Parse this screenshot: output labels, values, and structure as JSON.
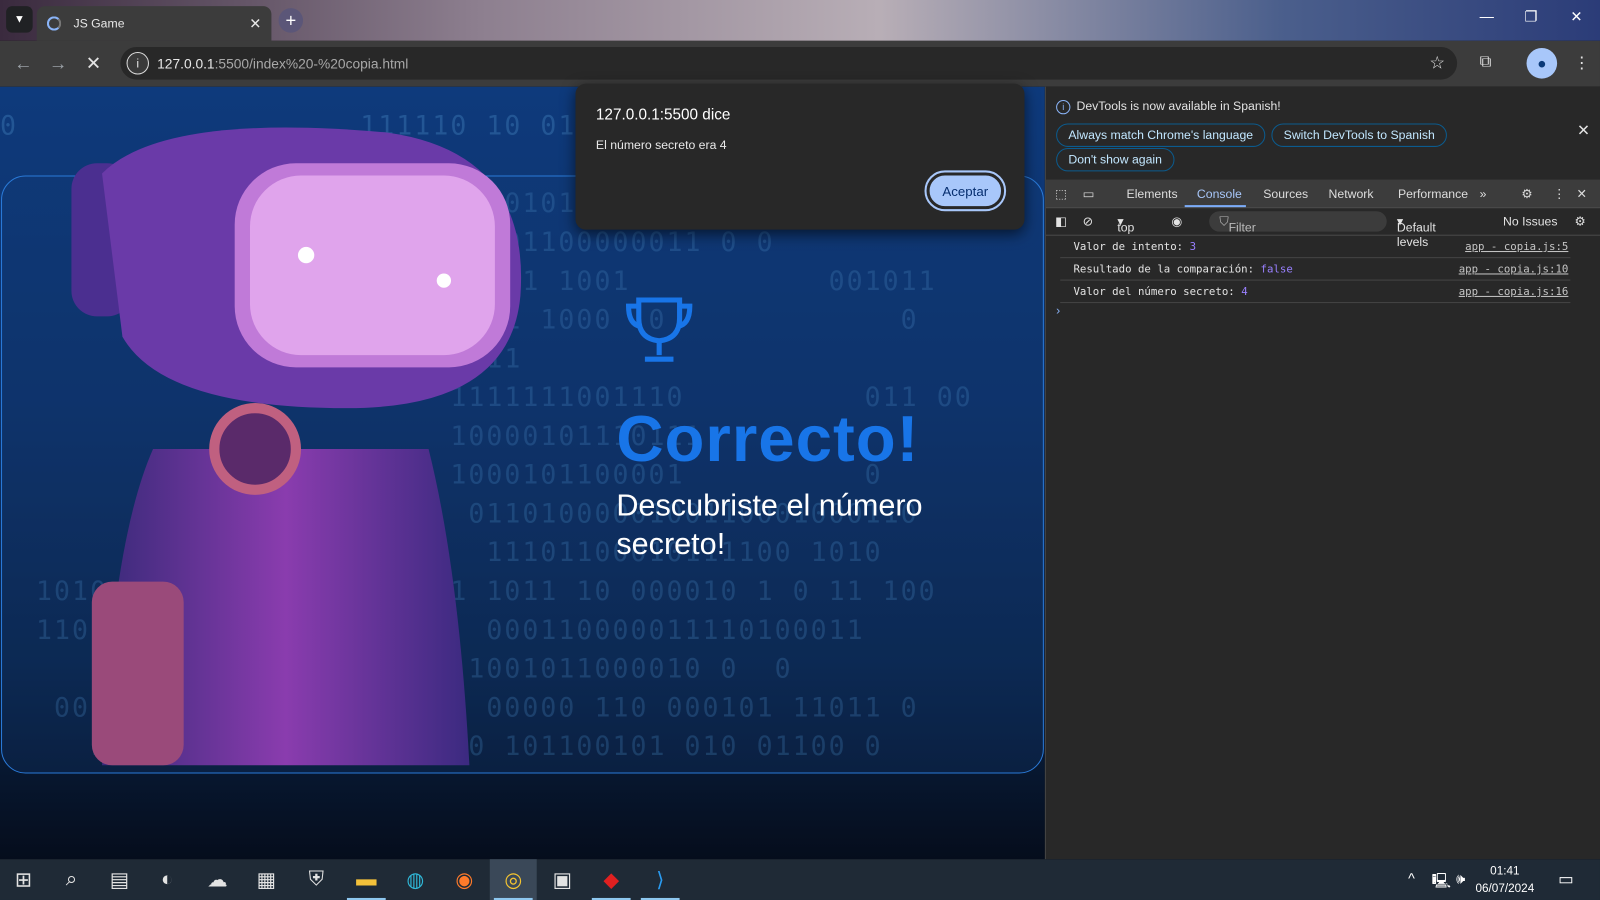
{
  "browser": {
    "tab_title": "JS Game",
    "url_host": "127.0.0.1",
    "url_rest": ":5500/index%20-%20copia.html"
  },
  "page": {
    "heading": "Correcto!",
    "subtitle": "Descubriste el número secreto!",
    "background_digits": [
      "0                   111110 10 01",
      "",
      "                          000101111  101101000010",
      "                          0001100000011 0 0",
      "                            01 1001           001011",
      "                          011 1000  0             0",
      "                          011",
      "                         1111111001110          011 00",
      "                         10000101110111",
      "                         1000101100001          0",
      "                          0110100000100110001000110",
      "                           11101100010111100 1010",
      "  1010          0101011 11 1011 10 000010 1 0 11 100",
      "  110                      000110000011110100011",
      "                          1001011000010 0  0",
      "   00  0 10                00000 110 000101 11011 0",
      "     10100 010 11 101101000 101100101 010 01100 0"
    ]
  },
  "dialog": {
    "title": "127.0.0.1:5500 dice",
    "message": "El número secreto era 4",
    "ok": "Aceptar"
  },
  "devtools": {
    "banner": "DevTools is now available in Spanish!",
    "btn_match": "Always match Chrome's language",
    "btn_switch": "Switch DevTools to Spanish",
    "btn_dont": "Don't show again",
    "tabs": [
      "Elements",
      "Console",
      "Sources",
      "Network",
      "Performance"
    ],
    "context": "top",
    "filter_placeholder": "Filter",
    "levels": "Default levels",
    "issues": "No Issues",
    "logs": [
      {
        "msg": "Valor de intento: ",
        "val": "3",
        "src": "app - copia.js:5"
      },
      {
        "msg": "Resultado de la comparación: ",
        "val": "false",
        "src": "app - copia.js:10"
      },
      {
        "msg": "Valor del número secreto: ",
        "val": "4",
        "src": "app - copia.js:16"
      }
    ]
  },
  "taskbar": {
    "time": "01:41",
    "date": "06/07/2024"
  },
  "colors": {
    "accent": "#1875e8",
    "dialog_button": "#a8c7fa",
    "console_value": "#9980ff"
  }
}
